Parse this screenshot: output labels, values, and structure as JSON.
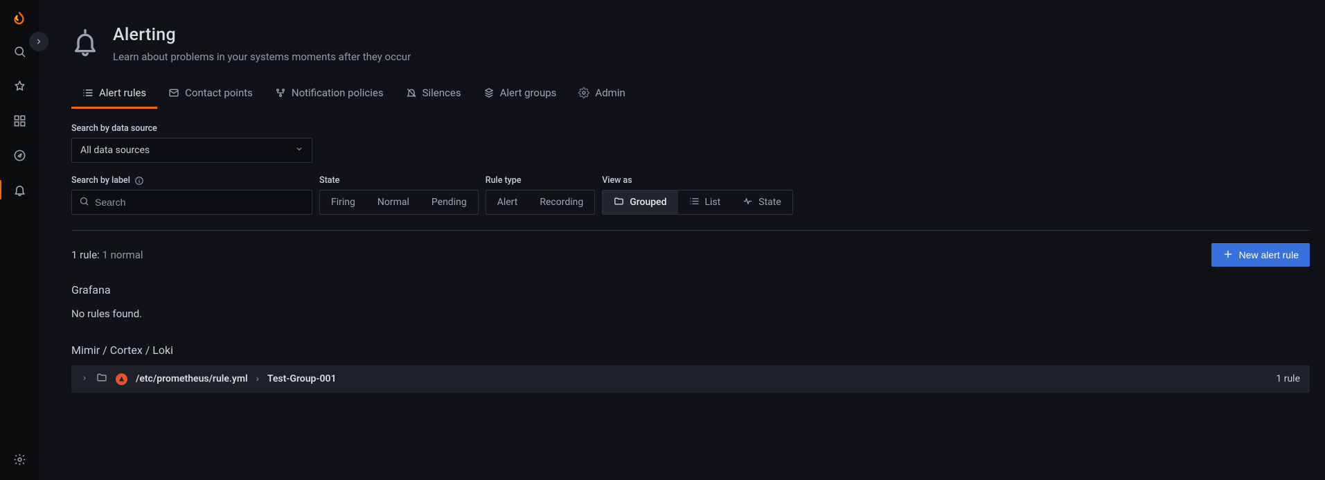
{
  "header": {
    "title": "Alerting",
    "subtitle": "Learn about problems in your systems moments after they occur"
  },
  "tabs": [
    {
      "id": "alert-rules",
      "label": "Alert rules"
    },
    {
      "id": "contact-points",
      "label": "Contact points"
    },
    {
      "id": "notification-policies",
      "label": "Notification policies"
    },
    {
      "id": "silences",
      "label": "Silences"
    },
    {
      "id": "alert-groups",
      "label": "Alert groups"
    },
    {
      "id": "admin",
      "label": "Admin"
    }
  ],
  "filters": {
    "datasource_label": "Search by data source",
    "datasource_value": "All data sources",
    "label_search_label": "Search by label",
    "label_search_placeholder": "Search",
    "state_label": "State",
    "state_options": [
      "Firing",
      "Normal",
      "Pending"
    ],
    "ruletype_label": "Rule type",
    "ruletype_options": [
      "Alert",
      "Recording"
    ],
    "view_label": "View as",
    "view_options": [
      "Grouped",
      "List",
      "State"
    ],
    "view_active": "Grouped"
  },
  "summary": {
    "count_prefix": "1 rule:",
    "count_suffix": "1 normal"
  },
  "new_button": "New alert rule",
  "sections": {
    "grafana": {
      "title": "Grafana",
      "empty": "No rules found."
    },
    "mimir": {
      "title": "Mimir / Cortex / Loki",
      "group": {
        "path": "/etc/prometheus/rule.yml",
        "name": "Test-Group-001",
        "count": "1 rule"
      }
    }
  }
}
